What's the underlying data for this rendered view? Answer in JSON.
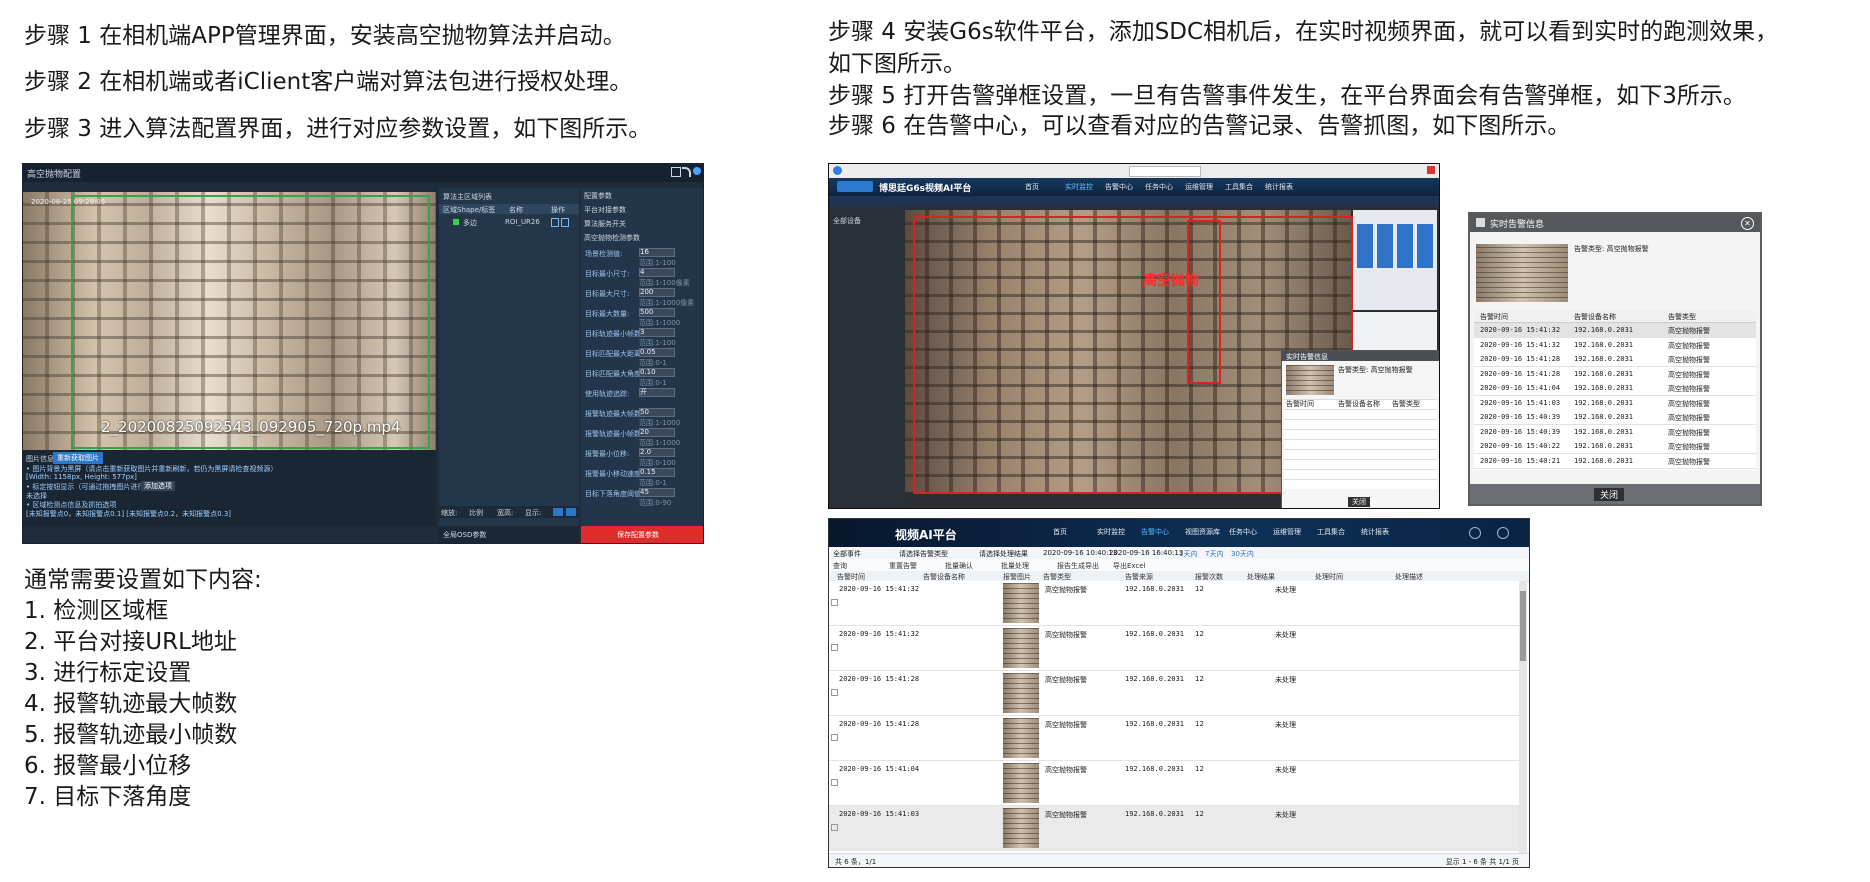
{
  "left_steps": [
    "步骤 1 在相机端APP管理界面，安装高空抛物算法并启动。",
    "步骤 2 在相机端或者iClient客户端对算法包进行授权处理。",
    "步骤 3 进入算法配置界面，进行对应参数设置，如下图所示。"
  ],
  "right_steps": [
    "步骤 4 安装G6s软件平台，添加SDC相机后，在实时视频界面，就可以看到实时的跑测效果，",
    "如下图所示。",
    "步骤 5 打开告警弹框设置，一旦有告警事件发生，在平台界面会有告警弹框，如下3所示。",
    "步骤 6 在告警中心，可以查看对应的告警记录、告警抓图，如下图所示。"
  ],
  "settings_intro": "通常需要设置如下内容:",
  "settings_list": [
    "1. 检测区域框",
    "2. 平台对接URL地址",
    "3. 进行标定设置",
    "4. 报警轨迹最大帧数",
    "5. 报警轨迹最小帧数",
    "6. 报警最小位移",
    "7. 目标下落角度"
  ],
  "config_screen": {
    "title": "高空抛物配置",
    "video_timestamp": "2020-08-25 09:29:05",
    "video_filename": "2_20200825092543_092905_720p.mp4",
    "region_panel_title": "算法主区域列表",
    "region_cols": [
      "区域Shape/标签",
      "名称",
      "操作"
    ],
    "region_row": {
      "shape": "多边",
      "name": "ROI_UR26"
    },
    "params_title": "配置参数",
    "section_labels": [
      "平台对接参数",
      "算法服务开关",
      "高空抛物检测参数"
    ],
    "params": [
      {
        "label": "场景检测值:",
        "value": "16",
        "hint": "范围:1-100"
      },
      {
        "label": "目标最小尺寸:",
        "value": "4",
        "hint": "范围:1-100像素"
      },
      {
        "label": "目标最大尺寸:",
        "value": "200",
        "hint": "范围:1-1000像素"
      },
      {
        "label": "目标最大数量:",
        "value": "500",
        "hint": "范围:1-1000"
      },
      {
        "label": "目标轨迹最小帧数:",
        "value": "3",
        "hint": "范围:1-100"
      },
      {
        "label": "目标匹配最大距离:",
        "value": "0.05",
        "hint": "范围:0-1"
      },
      {
        "label": "目标匹配最大角度:",
        "value": "0.10",
        "hint": "范围:0-1"
      },
      {
        "label": "使用轨迹追踪:",
        "value": "开",
        "hint": ""
      },
      {
        "label": "报警轨迹最大帧数:",
        "value": "50",
        "hint": "范围:1-1000"
      },
      {
        "label": "报警轨迹最小帧数:",
        "value": "20",
        "hint": "范围:1-1000"
      },
      {
        "label": "报警最小位移:",
        "value": "2.0",
        "hint": "范围:0-100"
      },
      {
        "label": "报警最小移动速度:",
        "value": "0.15",
        "hint": "范围:0-1"
      },
      {
        "label": "目标下落角度阈值:",
        "value": "45",
        "hint": "范围:0-90"
      }
    ],
    "info_heading": "图片信息",
    "info_button": "重新获取图片",
    "info_lines": [
      "• 图片背景为黑屏（请点击重新获取图片并重新刷新，若仍为黑屏请检查视频源）",
      "  [Width: 1158px, Height: 577px]",
      "• 标定按钮显示（可通过拖拽图片进行区域编辑）",
      "  未选择",
      "• 区域检测点信息及抓拍选项",
      "  [未知报警点0，未知报警点0.1] [未知报警点0.2，未知报警点0.3]"
    ],
    "calibration_button": "添加选项",
    "footer_label": "全局OSD参数",
    "zoom_labels": [
      "缩放:",
      "比例",
      "宽高:",
      "显示:"
    ],
    "save_button": "保存配置参数"
  },
  "realtime_screen": {
    "app_title": "博思廷G6s视频AI平台",
    "nav": [
      "首页",
      "实时监控",
      "告警中心",
      "任务中心",
      "运维管理",
      "工具集合",
      "统计报表"
    ],
    "overlay_label": "高空抛物",
    "popup_title": "实时告警信息",
    "popup_type": "告警类型: 高空抛物报警",
    "popup_cols": [
      "告警时间",
      "告警设备名称",
      "告警类型"
    ],
    "popup_close": "关闭",
    "tree_root": "全部设备"
  },
  "alarm_popup": {
    "title": "实时告警信息",
    "alarm_type": "告警类型: 高空抛物报警",
    "cols": [
      "告警时间",
      "告警设备名称",
      "告警类型"
    ],
    "rows": [
      [
        "2020-09-16 15:41:32",
        "192.168.0.2031",
        "高空抛物报警"
      ],
      [
        "2020-09-16 15:41:32",
        "192.168.0.2031",
        "高空抛物报警"
      ],
      [
        "2020-09-16 15:41:28",
        "192.168.0.2031",
        "高空抛物报警"
      ],
      [
        "2020-09-16 15:41:28",
        "192.168.0.2031",
        "高空抛物报警"
      ],
      [
        "2020-09-16 15:41:04",
        "192.168.0.2031",
        "高空抛物报警"
      ],
      [
        "2020-09-16 15:41:03",
        "192.168.0.2031",
        "高空抛物报警"
      ],
      [
        "2020-09-16 15:40:39",
        "192.168.0.2031",
        "高空抛物报警"
      ],
      [
        "2020-09-16 15:40:39",
        "192.168.0.2031",
        "高空抛物报警"
      ],
      [
        "2020-09-16 15:40:22",
        "192.168.0.2031",
        "高空抛物报警"
      ],
      [
        "2020-09-16 15:40:21",
        "192.168.0.2031",
        "高空抛物报警"
      ]
    ],
    "close": "关闭"
  },
  "alarm_center": {
    "brand": "视频AI平台",
    "nav": [
      "首页",
      "实时监控",
      "告警中心",
      "视图资源库",
      "任务中心",
      "运维管理",
      "工具集合",
      "统计报表"
    ],
    "filters": [
      "全部事件",
      "请选择告警类型",
      "请选择处理结果",
      "2020-09-16 10:40:13",
      "2020-09-16 16:40:13",
      "1天内",
      "7天内",
      "30天内"
    ],
    "toolbar": [
      "查询",
      "重置告警",
      "批量确认",
      "批量处理",
      "报告生成导出",
      "导出Excel"
    ],
    "cols": [
      "告警时间",
      "告警设备名称",
      "报警图片",
      "告警类型",
      "告警来源",
      "报警次数",
      "处理结果",
      "处理时间",
      "处理描述"
    ],
    "rows": [
      [
        "2020-09-16 15:41:32",
        "高空抛物报警",
        "192.168.0.2031",
        "12",
        "未处理"
      ],
      [
        "2020-09-16 15:41:32",
        "高空抛物报警",
        "192.168.0.2031",
        "12",
        "未处理"
      ],
      [
        "2020-09-16 15:41:28",
        "高空抛物报警",
        "192.168.0.2031",
        "12",
        "未处理"
      ],
      [
        "2020-09-16 15:41:28",
        "高空抛物报警",
        "192.168.0.2031",
        "12",
        "未处理"
      ],
      [
        "2020-09-16 15:41:04",
        "高空抛物报警",
        "192.168.0.2031",
        "12",
        "未处理"
      ],
      [
        "2020-09-16 15:41:03",
        "高空抛物报警",
        "192.168.0.2031",
        "12",
        "未处理"
      ]
    ],
    "pager": "共 6 条，1/1",
    "footer_right": "显示 1 - 6 条 共 1/1 页"
  }
}
